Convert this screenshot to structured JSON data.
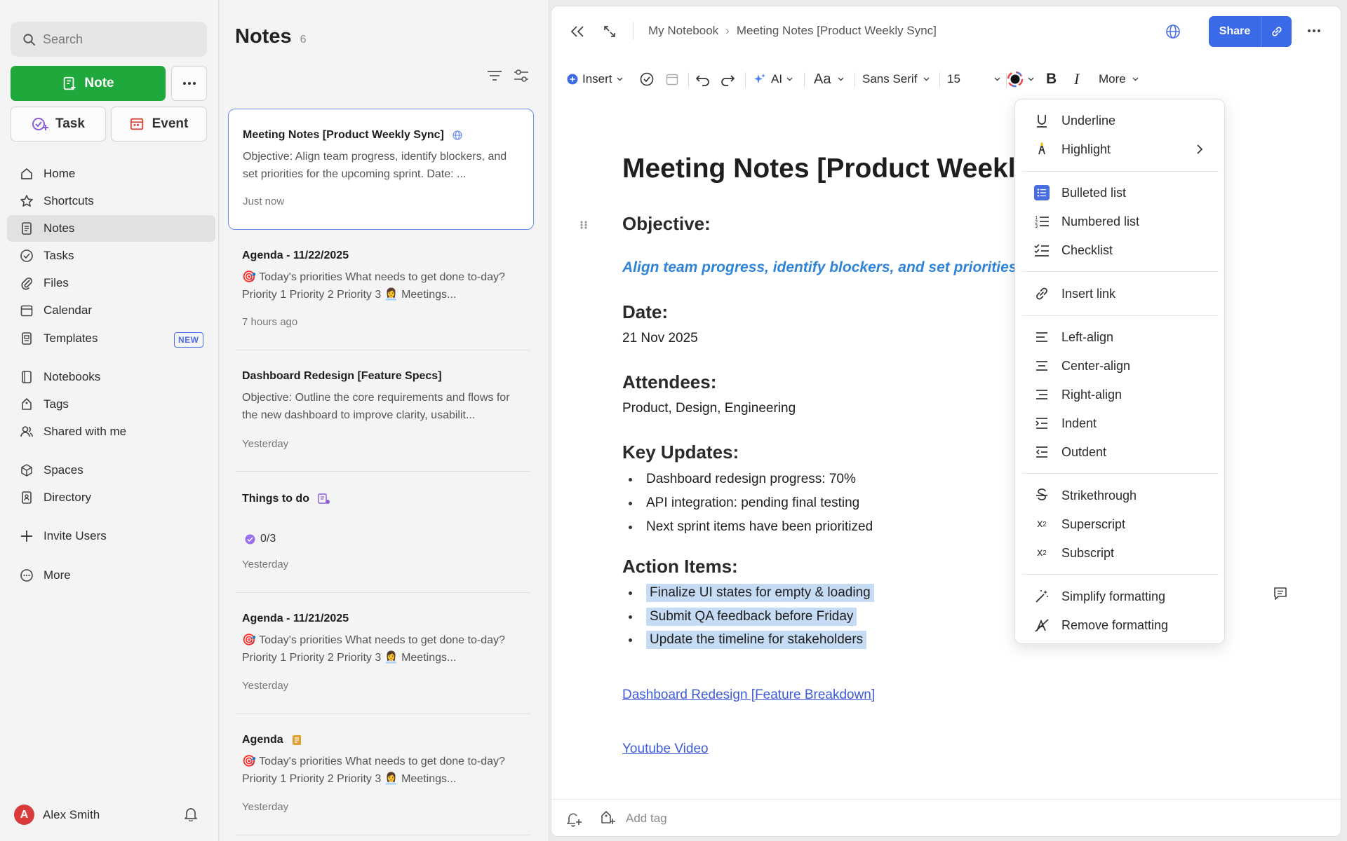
{
  "sidebar": {
    "search_placeholder": "Search",
    "note_button": "Note",
    "task_button": "Task",
    "event_button": "Event",
    "nav": [
      "Home",
      "Shortcuts",
      "Notes",
      "Tasks",
      "Files",
      "Calendar",
      "Templates",
      "Notebooks",
      "Tags",
      "Shared with me",
      "Spaces",
      "Directory",
      "Invite Users",
      "More"
    ],
    "templates_badge": "NEW",
    "user": {
      "initial": "A",
      "name": "Alex Smith"
    }
  },
  "notes_list": {
    "title": "Notes",
    "count": "6",
    "items": [
      {
        "title": "Meeting Notes [Product Weekly Sync]",
        "body": "Objective: Align team progress, identify blockers, and set priorities for the upcoming sprint. Date: ...",
        "time": "Just now"
      },
      {
        "title": "Agenda - 11/22/2025",
        "body": "🎯 Today's priorities What needs to get done to-day? Priority 1 Priority 2 Priority 3 👩‍💼 Meetings...",
        "time": "7 hours ago"
      },
      {
        "title": "Dashboard Redesign [Feature Specs]",
        "body": "Objective: Outline the core requirements and flows for the new dashboard to improve clarity, usabilit...",
        "time": "Yesterday"
      },
      {
        "title": "Things to do",
        "progress": "0/3",
        "time": "Yesterday"
      },
      {
        "title": "Agenda - 11/21/2025",
        "body": "🎯 Today's priorities What needs to get done to-day? Priority 1 Priority 2 Priority 3 👩‍💼 Meetings...",
        "time": "Yesterday"
      },
      {
        "title": "Agenda",
        "body": "🎯 Today's priorities What needs to get done to-day? Priority 1 Priority 2 Priority 3 👩‍💼 Meetings...",
        "time": "Yesterday"
      }
    ]
  },
  "editor": {
    "breadcrumb": [
      "My Notebook",
      "Meeting Notes [Product Weekly Sync]"
    ],
    "share_label": "Share",
    "toolbar": {
      "insert": "Insert",
      "ai": "AI",
      "font_family": "Sans Serif",
      "font_size": "15",
      "more": "More"
    },
    "doc": {
      "title": "Meeting Notes [Product Weekly Sync]",
      "objective_heading": "Objective:",
      "objective_text": "Align team progress, identify blockers, and set priorities for the upcoming sprint.",
      "date_heading": "Date:",
      "date_text": "21 Nov 2025",
      "attendees_heading": "Attendees:",
      "attendees_text": "Product, Design, Engineering",
      "updates_heading": "Key Updates:",
      "updates": [
        "Dashboard redesign progress: 70%",
        "API integration: pending final testing",
        "Next sprint items have been prioritized"
      ],
      "actions_heading": "Action Items:",
      "actions": [
        "Finalize UI states for empty & loading",
        "Submit QA feedback before Friday",
        "Update the timeline for stakeholders"
      ],
      "link1": "Dashboard Redesign [Feature Breakdown]",
      "link2": "Youtube Video"
    },
    "footer": {
      "add_tag_placeholder": "Add tag"
    }
  },
  "format_menu": {
    "items": [
      "Underline",
      "Highlight",
      "Bulleted list",
      "Numbered list",
      "Checklist",
      "Insert link",
      "Left-align",
      "Center-align",
      "Right-align",
      "Indent",
      "Outdent",
      "Strikethrough",
      "Superscript",
      "Subscript",
      "Simplify formatting",
      "Remove formatting"
    ]
  },
  "colors": {
    "accent": "#3a6ae8",
    "note_green": "#1fa83b",
    "objective_blue": "#2f84d8",
    "selection": "#c6dbf4",
    "link": "#3d5bd6"
  }
}
